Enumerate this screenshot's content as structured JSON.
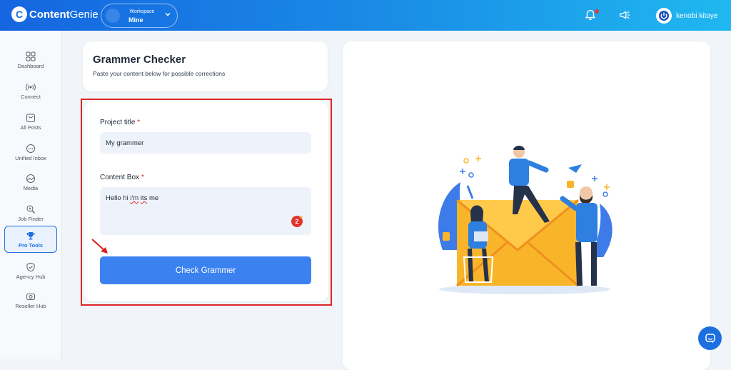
{
  "app": {
    "brand_bold": "Content",
    "brand_light": "Genie",
    "brand_mark": "C"
  },
  "workspace": {
    "label": "Workspace",
    "value": "Mine"
  },
  "user": {
    "name": "kenobi kitoye"
  },
  "sidebar": {
    "items": [
      {
        "label": "Dashboard",
        "icon": "grid-icon"
      },
      {
        "label": "Connect",
        "icon": "broadcast-icon"
      },
      {
        "label": "All Posts",
        "icon": "bag-icon"
      },
      {
        "label": "Unified Inbox",
        "icon": "chat-icon"
      },
      {
        "label": "Media",
        "icon": "media-icon"
      },
      {
        "label": "Job Finder",
        "icon": "search-doc-icon"
      },
      {
        "label": "Pro Tools",
        "icon": "trophy-icon"
      },
      {
        "label": "Agency Hub",
        "icon": "shield-check-icon"
      },
      {
        "label": "Reseller Hub",
        "icon": "camera-icon"
      }
    ],
    "active": "Pro Tools"
  },
  "page": {
    "title": "Grammer Checker",
    "subtitle": "Paste your content below for possible corrections"
  },
  "form": {
    "project_title_label": "Project title",
    "project_title_value": "My grammer",
    "content_label": "Content Box",
    "required_mark": "*",
    "content_pre": "Hello hi ",
    "content_misspelled": "i'm",
    "content_mid": " ",
    "content_misspelled2": "its",
    "content_post": " me",
    "grammarly_count": "2",
    "submit_label": "Check Grammer"
  },
  "colors": {
    "primary": "#3b82f0",
    "accent": "#1d6fe0",
    "highlight_box": "#dc2626",
    "required": "#dc2626"
  }
}
